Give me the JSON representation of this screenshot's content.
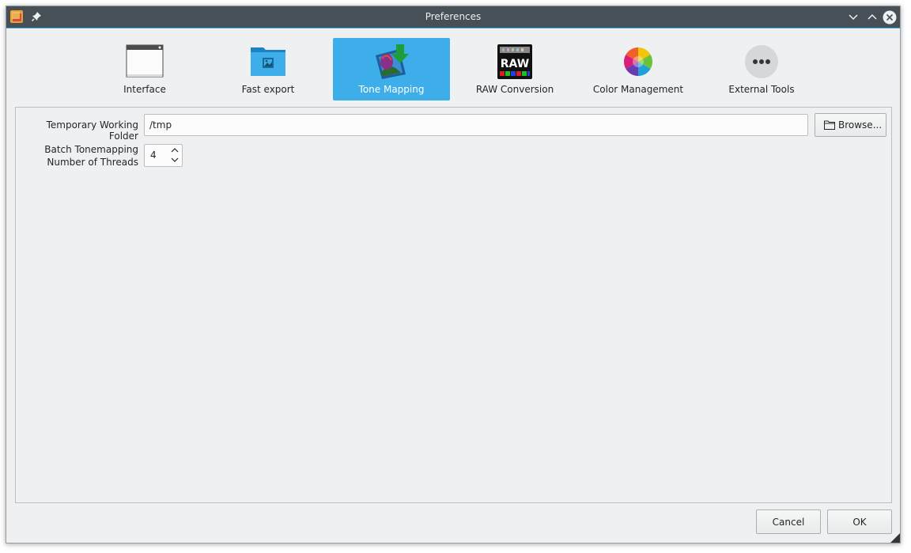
{
  "window": {
    "title": "Preferences",
    "accent_color": "#3daee9",
    "titlebar_color": "#475057"
  },
  "titlebar_icons": [
    "app-icon",
    "pin-icon",
    "minimize-icon",
    "maximize-icon",
    "close-icon"
  ],
  "pages": [
    {
      "label": "Interface",
      "icon": "window-icon",
      "active": false
    },
    {
      "label": "Fast export",
      "icon": "image-folder-icon",
      "active": false
    },
    {
      "label": "Tone Mapping",
      "icon": "tone-mapping-icon",
      "active": true
    },
    {
      "label": "RAW Conversion",
      "icon": "raw-icon",
      "active": false
    },
    {
      "label": "Color Management",
      "icon": "color-wheel-icon",
      "active": false
    },
    {
      "label": "External Tools",
      "icon": "more-icon",
      "active": false
    }
  ],
  "form": {
    "temp_folder_label": "Temporary Working Folder",
    "temp_folder_value": "/tmp",
    "browse_label": "Browse...",
    "threads_label_line1": "Batch Tonemapping",
    "threads_label_line2": "Number of Threads",
    "threads_value": "4"
  },
  "buttons": {
    "cancel": "Cancel",
    "ok": "OK"
  }
}
